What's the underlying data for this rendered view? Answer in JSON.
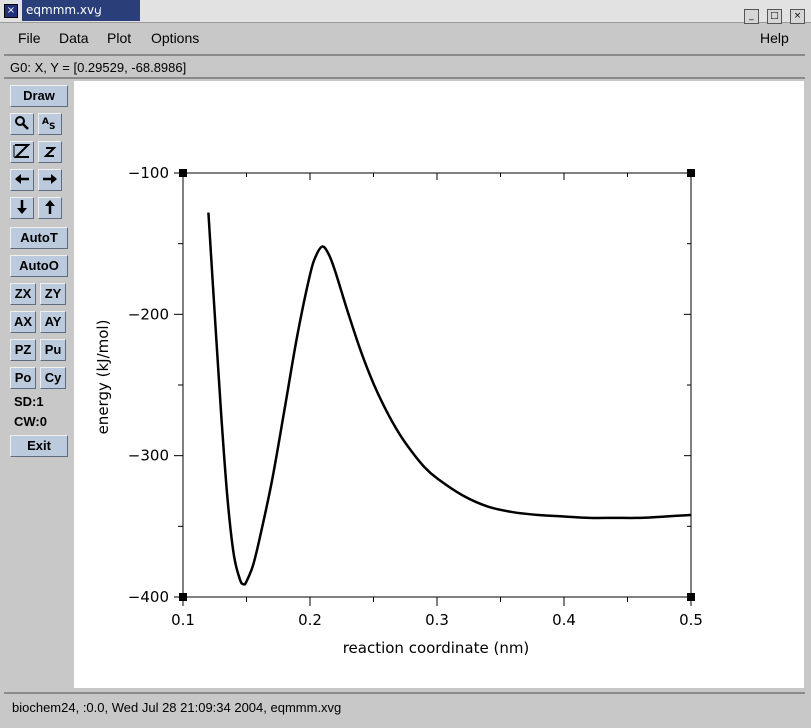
{
  "window": {
    "title": "eqmmm.xvg",
    "buttons": [
      "_",
      "□",
      "×"
    ]
  },
  "menubar": {
    "file": "File",
    "data": "Data",
    "plot": "Plot",
    "options": "Options",
    "help": "Help"
  },
  "coord_readout": "G0: X, Y = [0.29529, -68.8986]",
  "toolbar": {
    "draw": "Draw",
    "autot": "AutoT",
    "autoo": "AutoO",
    "zx": "ZX",
    "zy": "ZY",
    "ax": "AX",
    "ay": "AY",
    "pz": "PZ",
    "pu": "Pu",
    "po": "Po",
    "cy": "Cy",
    "sd": "SD:1",
    "cw": "CW:0",
    "exit": "Exit",
    "icons": [
      "magnifier-icon",
      "text-icon",
      "zoom-z-icon",
      "zoom-z-small-icon",
      "arrow-left-icon",
      "arrow-right-icon",
      "arrow-down-icon",
      "arrow-up-icon"
    ]
  },
  "status": "biochem24, :0.0, Wed Jul 28 21:09:34 2004, eqmmm.xvg",
  "chart_data": {
    "type": "line",
    "xlabel": "reaction coordinate (nm)",
    "ylabel": "energy (kJ/mol)",
    "xlim": [
      0.1,
      0.5
    ],
    "ylim": [
      -400,
      -100
    ],
    "xticks": [
      0.1,
      0.2,
      0.3,
      0.4,
      0.5
    ],
    "xtick_labels": [
      "0.1",
      "0.2",
      "0.3",
      "0.4",
      "0.5"
    ],
    "yticks": [
      -400,
      -300,
      -200,
      -100
    ],
    "ytick_labels": [
      "−400",
      "−300",
      "−200",
      "−100"
    ],
    "series": [
      {
        "x": [
          0.12,
          0.125,
          0.13,
          0.135,
          0.14,
          0.145,
          0.148,
          0.15,
          0.155,
          0.16,
          0.17,
          0.18,
          0.19,
          0.2,
          0.205,
          0.21,
          0.215,
          0.22,
          0.23,
          0.24,
          0.25,
          0.26,
          0.27,
          0.28,
          0.29,
          0.3,
          0.32,
          0.34,
          0.36,
          0.38,
          0.4,
          0.42,
          0.44,
          0.46,
          0.48,
          0.5
        ],
        "y": [
          -128,
          -200,
          -270,
          -330,
          -370,
          -388,
          -391,
          -389,
          -378,
          -360,
          -318,
          -267,
          -215,
          -172,
          -158,
          -152,
          -158,
          -170,
          -199,
          -226,
          -249,
          -268,
          -284,
          -297,
          -308,
          -316,
          -328,
          -336,
          -340,
          -342,
          -343,
          -344,
          -344,
          -344,
          -343,
          -342
        ],
        "color": "#000000"
      }
    ]
  }
}
